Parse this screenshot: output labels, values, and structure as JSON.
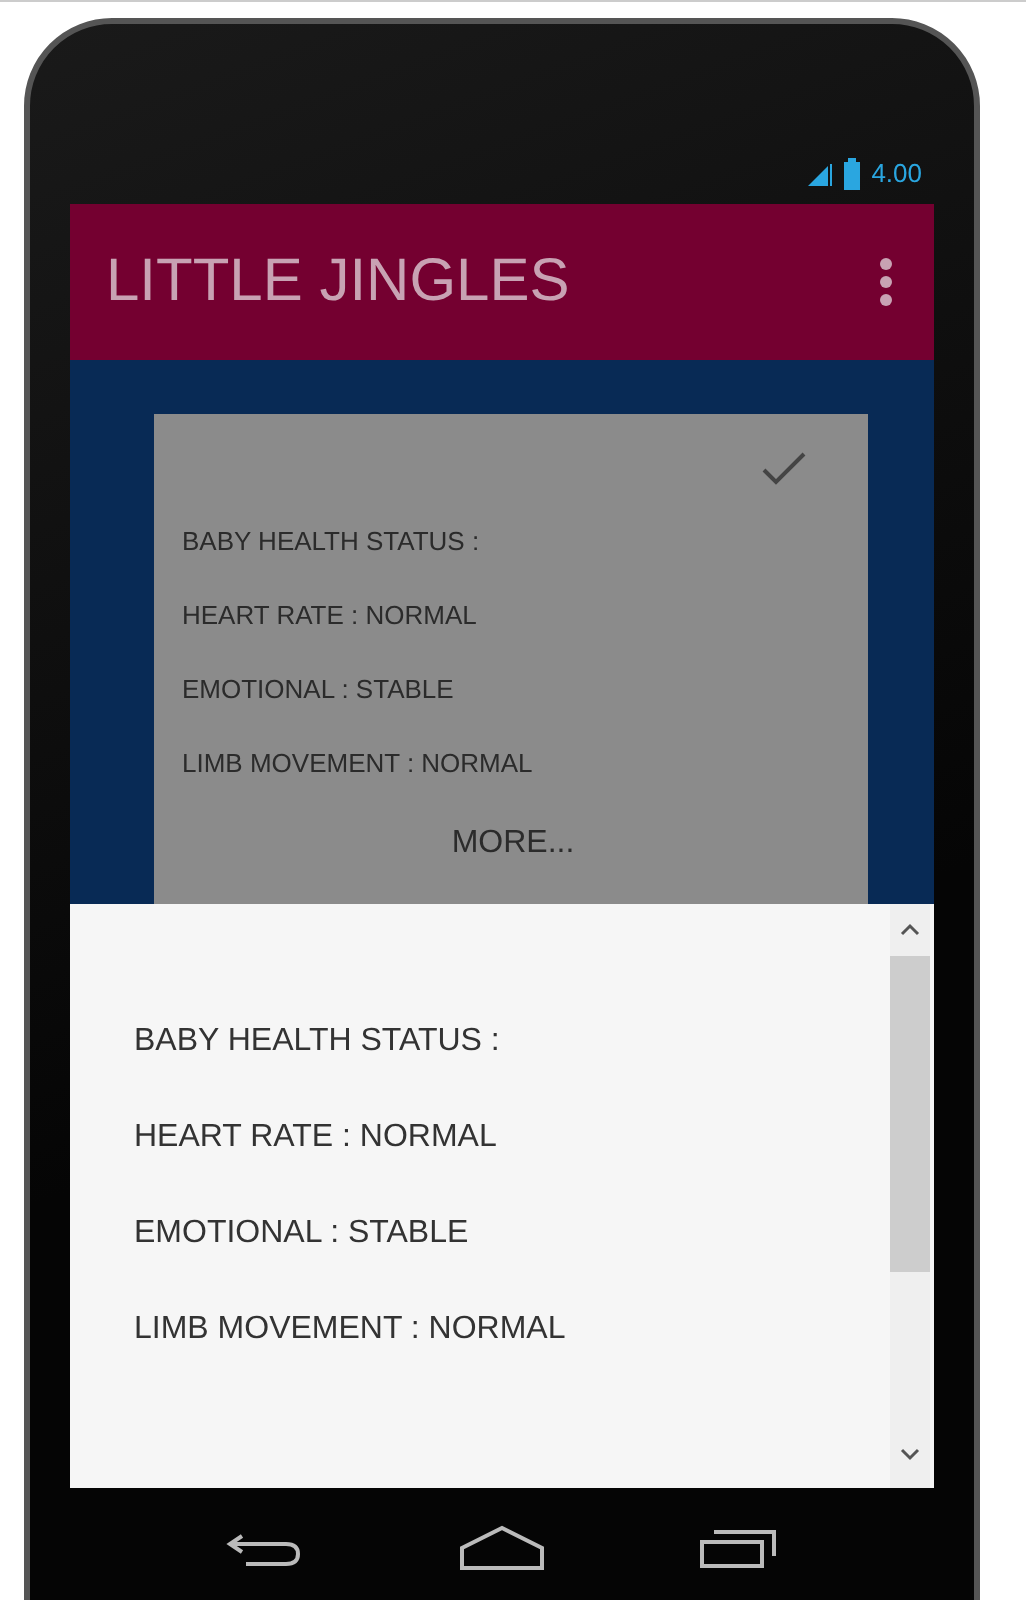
{
  "status_bar": {
    "time": "4.00"
  },
  "app_bar": {
    "title": "LITTLE JINGLES"
  },
  "card": {
    "lines": [
      "BABY HEALTH STATUS :",
      "HEART RATE : NORMAL",
      "EMOTIONAL : STABLE",
      "LIMB MOVEMENT : NORMAL"
    ],
    "more_button": "MORE..."
  },
  "bottom_sheet": {
    "lines": [
      "BABY HEALTH STATUS :",
      "HEART RATE : NORMAL",
      "EMOTIONAL : STABLE",
      "LIMB MOVEMENT : NORMAL"
    ]
  }
}
